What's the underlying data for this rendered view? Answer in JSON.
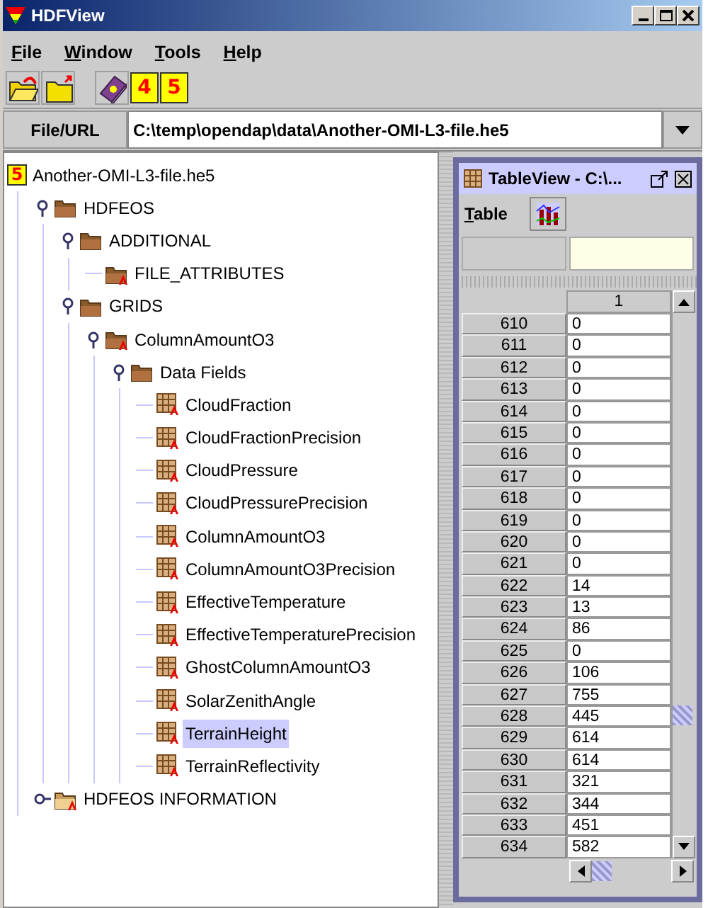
{
  "window": {
    "title": "HDFView"
  },
  "menu": [
    {
      "label": "File"
    },
    {
      "label": "Window"
    },
    {
      "label": "Tools"
    },
    {
      "label": "Help"
    }
  ],
  "toolbar": [
    {
      "kind": "open"
    },
    {
      "kind": "close"
    },
    {
      "kind": "gap"
    },
    {
      "kind": "help"
    },
    {
      "kind": "hdf",
      "glyph": "4"
    },
    {
      "kind": "hdf",
      "glyph": "5"
    }
  ],
  "url_bar": {
    "button": "File/URL",
    "value": "C:\\temp\\opendap\\data\\Another-OMI-L3-file.he5"
  },
  "tree": [
    {
      "label": "Another-OMI-L3-file.he5",
      "kind": "hdf5",
      "icon_glyph": "5",
      "selected": false,
      "children": [
        {
          "label": "HDFEOS",
          "kind": "folder",
          "expanded": true,
          "selected": false,
          "children": [
            {
              "label": "ADDITIONAL",
              "kind": "folder",
              "expanded": true,
              "selected": false,
              "children": [
                {
                  "label": "FILE_ATTRIBUTES",
                  "kind": "folder-attr",
                  "selected": false
                }
              ]
            },
            {
              "label": "GRIDS",
              "kind": "folder",
              "expanded": true,
              "selected": false,
              "children": [
                {
                  "label": "ColumnAmountO3",
                  "kind": "folder-attr",
                  "expanded": true,
                  "selected": false,
                  "children": [
                    {
                      "label": "Data Fields",
                      "kind": "folder",
                      "expanded": true,
                      "selected": false,
                      "children": [
                        {
                          "label": "CloudFraction",
                          "kind": "dataset",
                          "selected": false
                        },
                        {
                          "label": "CloudFractionPrecision",
                          "kind": "dataset",
                          "selected": false
                        },
                        {
                          "label": "CloudPressure",
                          "kind": "dataset",
                          "selected": false
                        },
                        {
                          "label": "CloudPressurePrecision",
                          "kind": "dataset",
                          "selected": false
                        },
                        {
                          "label": "ColumnAmountO3",
                          "kind": "dataset",
                          "selected": false
                        },
                        {
                          "label": "ColumnAmountO3Precision",
                          "kind": "dataset",
                          "selected": false
                        },
                        {
                          "label": "EffectiveTemperature",
                          "kind": "dataset",
                          "selected": false
                        },
                        {
                          "label": "EffectiveTemperaturePrecision",
                          "kind": "dataset",
                          "selected": false
                        },
                        {
                          "label": "GhostColumnAmountO3",
                          "kind": "dataset",
                          "selected": false
                        },
                        {
                          "label": "SolarZenithAngle",
                          "kind": "dataset",
                          "selected": false
                        },
                        {
                          "label": "TerrainHeight",
                          "kind": "dataset",
                          "selected": true
                        },
                        {
                          "label": "TerrainReflectivity",
                          "kind": "dataset",
                          "selected": false
                        }
                      ]
                    }
                  ]
                }
              ]
            }
          ]
        },
        {
          "label": "HDFEOS INFORMATION",
          "kind": "folder-info",
          "expanded": false,
          "selected": false
        }
      ]
    }
  ],
  "table_view": {
    "title": "TableView - C:\\...",
    "menu": "Table",
    "column": "1",
    "rows": [
      [
        "610",
        "0"
      ],
      [
        "611",
        "0"
      ],
      [
        "612",
        "0"
      ],
      [
        "613",
        "0"
      ],
      [
        "614",
        "0"
      ],
      [
        "615",
        "0"
      ],
      [
        "616",
        "0"
      ],
      [
        "617",
        "0"
      ],
      [
        "618",
        "0"
      ],
      [
        "619",
        "0"
      ],
      [
        "620",
        "0"
      ],
      [
        "621",
        "0"
      ],
      [
        "622",
        "14"
      ],
      [
        "623",
        "13"
      ],
      [
        "624",
        "86"
      ],
      [
        "625",
        "0"
      ],
      [
        "626",
        "106"
      ],
      [
        "627",
        "755"
      ],
      [
        "628",
        "445"
      ],
      [
        "629",
        "614"
      ],
      [
        "630",
        "614"
      ],
      [
        "631",
        "321"
      ],
      [
        "632",
        "344"
      ],
      [
        "633",
        "451"
      ],
      [
        "634",
        "582"
      ]
    ]
  }
}
